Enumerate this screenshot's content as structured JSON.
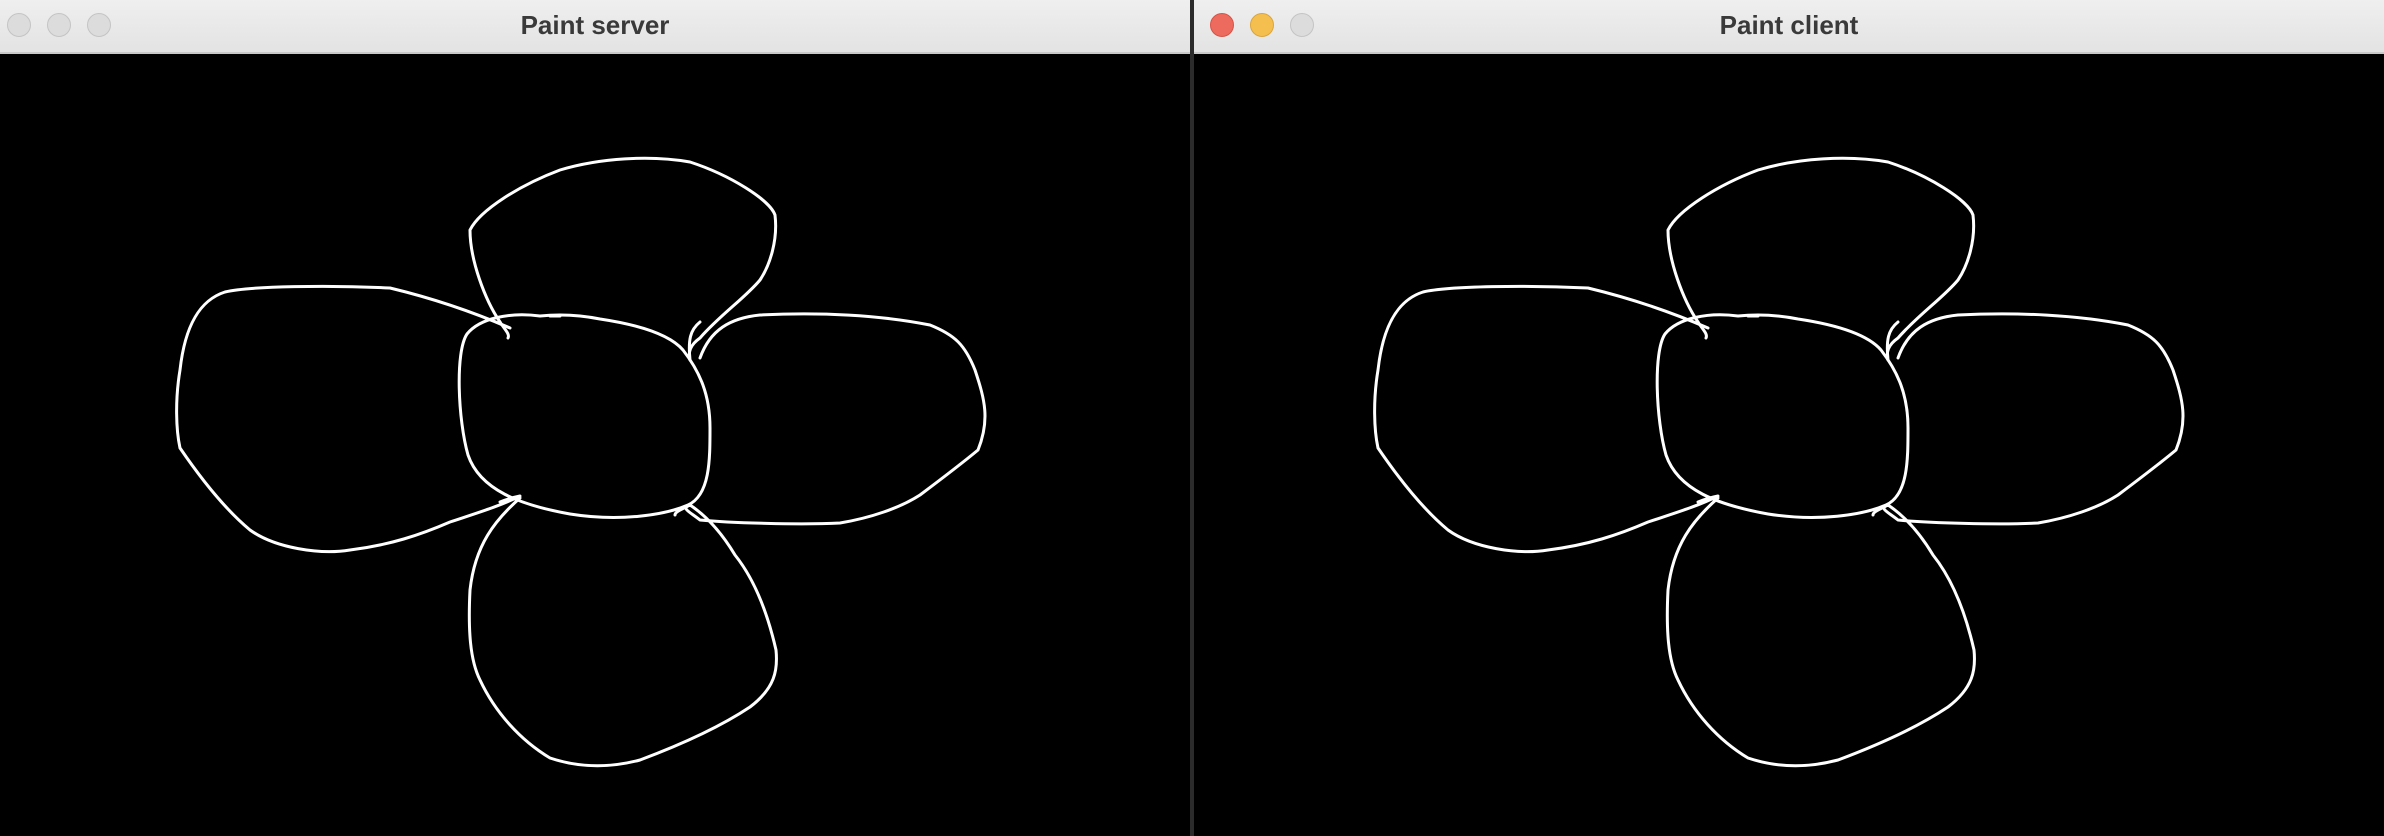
{
  "server_window": {
    "title": "Paint server",
    "close_icon": "close-icon",
    "minimize_icon": "minimize-icon",
    "zoom_icon": "zoom-icon",
    "focused": false
  },
  "client_window": {
    "title": "Paint client",
    "close_icon": "close-icon",
    "minimize_icon": "minimize-icon",
    "zoom_icon": "zoom-icon",
    "focused": true
  },
  "canvas": {
    "background": "#000000",
    "stroke_color": "#ffffff",
    "drawing": "four-petal flower outline"
  },
  "colors": {
    "titlebar": "#e8e8e8",
    "title_text": "#3a3a3a",
    "close": "#ed6a5e",
    "minimize": "#f5bf4f",
    "inactive_button": "#dcdcdc"
  }
}
